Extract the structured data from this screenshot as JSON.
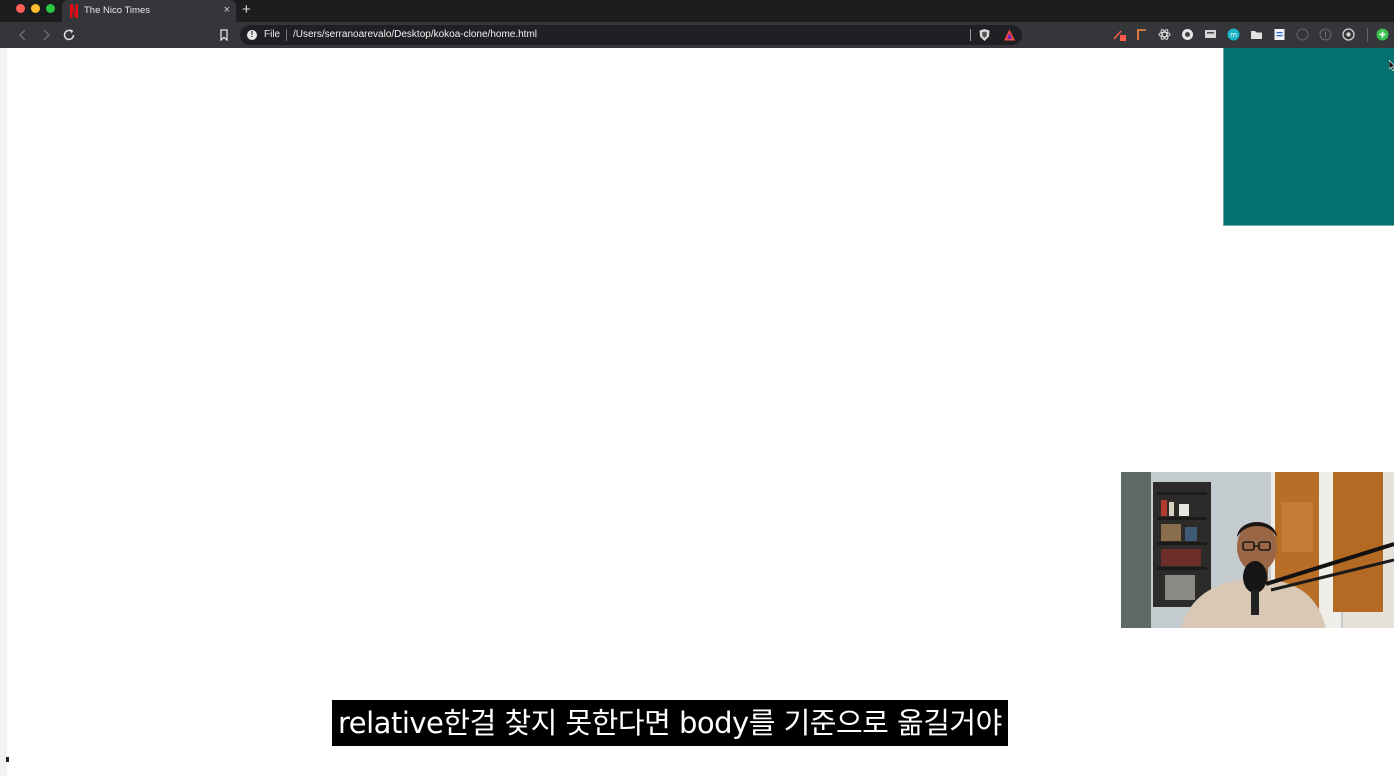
{
  "browser": {
    "tab_title": "The Nico Times",
    "tab_close": "×",
    "new_tab": "+",
    "address": {
      "scheme_label": "File",
      "url": "/Users/serranoarevalo/Desktop/kokoa-clone/home.html"
    }
  },
  "page": {
    "box_color": "#02716f"
  },
  "subtitle": {
    "text": "relative한걸 찾지 못한다면 body를 기준으로 옮길거야"
  },
  "icons": {
    "back": "back-arrow-icon",
    "forward": "forward-arrow-icon",
    "reload": "reload-icon",
    "bookmark": "bookmark-icon",
    "info": "info-icon",
    "brave_shield": "brave-shield-icon",
    "brave_rewards": "brave-rewards-icon"
  }
}
